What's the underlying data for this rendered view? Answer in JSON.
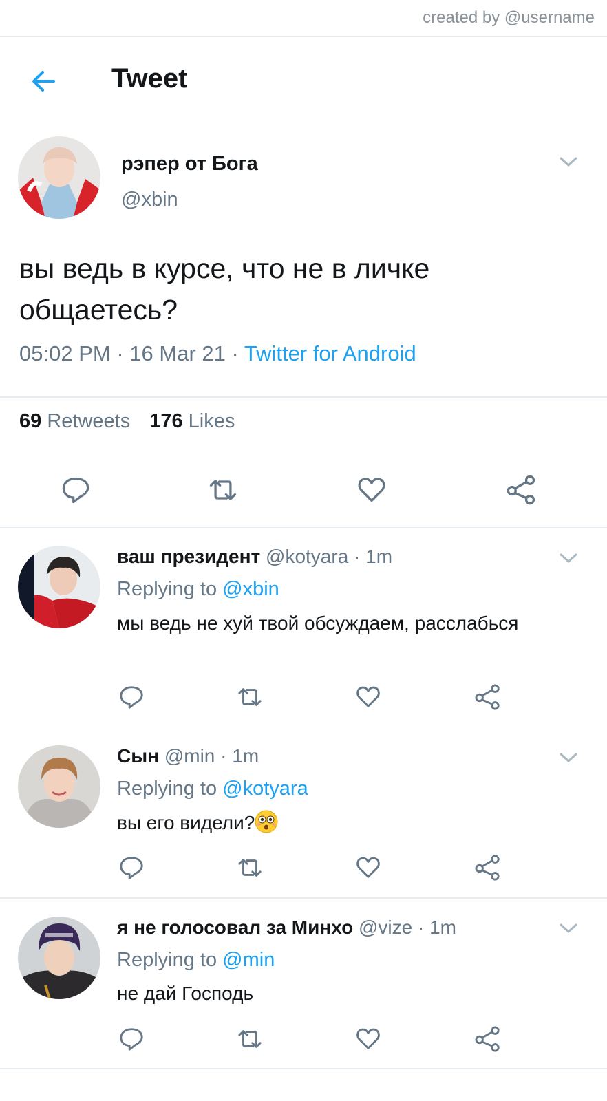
{
  "watermark": "created by @username",
  "header": {
    "title": "Tweet",
    "back_icon": "arrow-left-icon"
  },
  "colors": {
    "accent": "#1da1f2",
    "text": "#14171a",
    "muted": "#657786",
    "divider": "#e6ecf0"
  },
  "tweet": {
    "name": "рэпер от Бога",
    "handle": "@xbin",
    "text": "вы ведь в курсе, что не в личке общаетесь?",
    "time": "05:02 PM",
    "date": "16 Mar 21",
    "source": "Twitter for Android",
    "sep": "·",
    "retweets_count": "69",
    "retweets_label": "Retweets",
    "likes_count": "176",
    "likes_label": "Likes"
  },
  "replies": [
    {
      "name": "ваш президент",
      "handle": "@kotyara",
      "time": "1m",
      "replying_label": "Replying to",
      "replying_to": "@xbin",
      "text": "мы ведь не хуй твой обсуждаем, расслабься"
    },
    {
      "name": "Сын",
      "handle": "@min",
      "time": "1m",
      "replying_label": "Replying to",
      "replying_to": "@kotyara",
      "text": "вы его видели?",
      "emoji": "flushed-face-emoji"
    },
    {
      "name": "я не голосовал за Минхо",
      "handle": "@vize",
      "time": "1m",
      "replying_label": "Replying to",
      "replying_to": "@min",
      "text": "не дай Господь"
    }
  ],
  "action_icons": [
    "reply-icon",
    "retweet-icon",
    "like-icon",
    "share-icon"
  ]
}
